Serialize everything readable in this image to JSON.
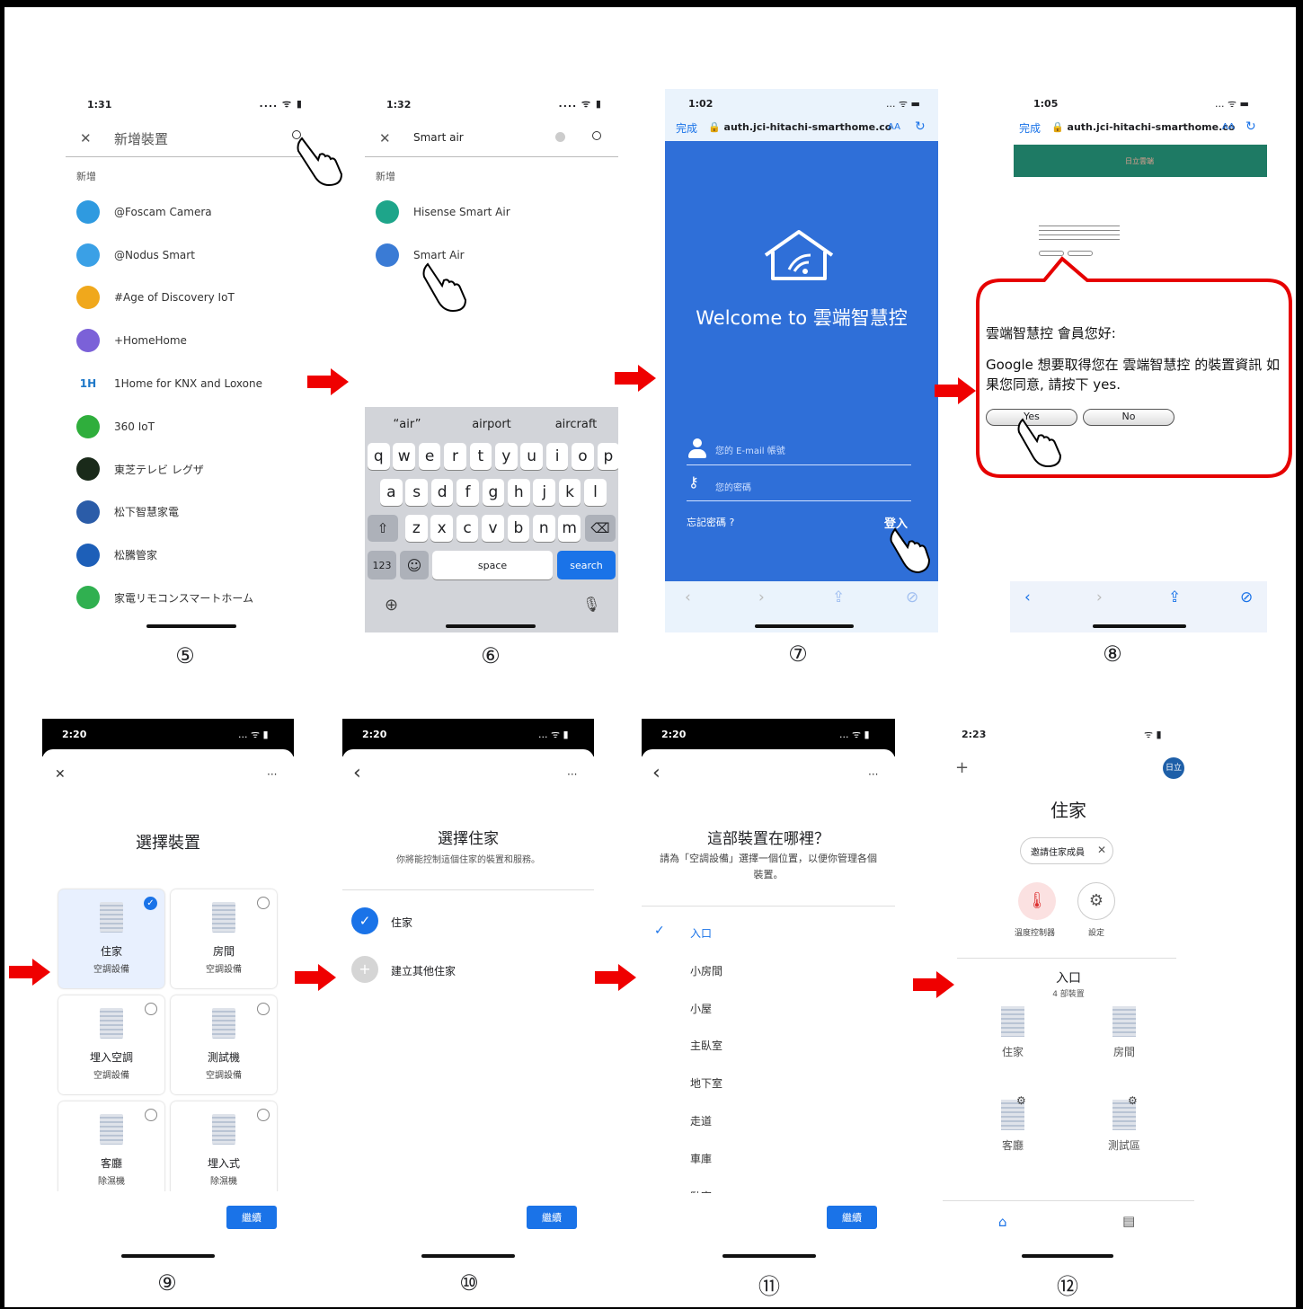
{
  "step_numbers": [
    "⑤",
    "⑥",
    "⑦",
    "⑧",
    "⑨",
    "⑩",
    "⑪",
    "⑫"
  ],
  "colors": {
    "arrow": "#ef0000",
    "google_blue": "#1a73e8",
    "hitachi_blue": "#2f6fd8",
    "hitachi_green": "#1e7a64"
  },
  "s5": {
    "time": "1:31",
    "status_icons": ".... ᯤ ▮",
    "close_icon": "✕",
    "search_title": "新增裝置",
    "section": "新增",
    "items": [
      {
        "name": "@Foscam Camera",
        "icon": "cloud-icon",
        "color": "#2f9ae0"
      },
      {
        "name": "@Nodus Smart",
        "icon": "at-icon",
        "color": "#3aa0e6"
      },
      {
        "name": "#Age of Discovery IoT",
        "icon": "globe-icon",
        "color": "#f0a81c"
      },
      {
        "name": "+HomeHome",
        "icon": "building-icon",
        "color": "#7b61d8"
      },
      {
        "name": "1Home for KNX and Loxone",
        "icon": "1h-icon",
        "color": "#ffffff"
      },
      {
        "name": "360 IoT",
        "icon": "plus-icon",
        "color": "#2fae3c"
      },
      {
        "name": "東芝テレビ レグザ",
        "icon": "regza-icon",
        "color": "#1a2a1a"
      },
      {
        "name": "松下智慧家電",
        "icon": "panasonic-icon",
        "color": "#2b5ca8"
      },
      {
        "name": "松騰管家",
        "icon": "m-icon",
        "color": "#1d5fb8"
      },
      {
        "name": "家電リモコンスマートホーム",
        "icon": "house-icon",
        "color": "#30b050"
      }
    ],
    "onehour_label": "1H"
  },
  "s6": {
    "time": "1:32",
    "status_icons": ".... ᯤ ▮",
    "close_icon": "✕",
    "search_value": "Smart air",
    "section": "新增",
    "items": [
      {
        "name": "Hisense Smart Air",
        "icon": "hisense-icon",
        "color": "#1ea58a"
      },
      {
        "name": "Smart Air",
        "icon": "smart-air-icon",
        "color": "#3a7bd5"
      }
    ],
    "suggestions": [
      "“air”",
      "airport",
      "aircraft"
    ],
    "row1": [
      "q",
      "w",
      "e",
      "r",
      "t",
      "y",
      "u",
      "i",
      "o",
      "p"
    ],
    "row2": [
      "a",
      "s",
      "d",
      "f",
      "g",
      "h",
      "j",
      "k",
      "l"
    ],
    "row3": [
      "z",
      "x",
      "c",
      "v",
      "b",
      "n",
      "m"
    ],
    "shift": "⇧",
    "backspace": "⌫",
    "num_key": "123",
    "emoji_key": "☺",
    "space": "space",
    "search": "search",
    "globe": "⊕",
    "mic": "🎙"
  },
  "s7": {
    "time": "1:02",
    "status_icons": "... ᯤ ▬",
    "done": "完成",
    "url": "🔒 auth.jci-hitachi-smarthome.co",
    "aa": "AA",
    "reload": "↻",
    "welcome": "Welcome to 雲端智慧控",
    "email_placeholder": "您的 E-mail 帳號",
    "password_placeholder": "您的密碼",
    "forgot": "忘記密碼 ?",
    "login": "登入",
    "nav": [
      "‹",
      "›",
      "⇪",
      "⊘"
    ]
  },
  "s8": {
    "time": "1:05",
    "status_icons": "... ᯤ ▬",
    "done": "完成",
    "url": "🔒 auth.jci-hitachi-smarthome.co",
    "aa": "AA",
    "reload": "↻",
    "header_text": "日立雲端",
    "greeting": "雲端智慧控 會員您好:",
    "message": "Google 想要取得您在 雲端智慧控 的裝置資訊 如果您同意, 請按下 yes.",
    "yes": "Yes",
    "no": "No",
    "nav": [
      "‹",
      "›",
      "⇪",
      "⊘"
    ]
  },
  "s9": {
    "time": "2:20",
    "status_icons": "... ᯤ ▮",
    "close_icon": "✕",
    "more_icon": "···",
    "title": "選擇裝置",
    "devices": [
      {
        "name": "住家",
        "type": "空調設備",
        "selected": true
      },
      {
        "name": "房間",
        "type": "空調設備",
        "selected": false
      },
      {
        "name": "埋入空調",
        "type": "空調設備",
        "selected": false
      },
      {
        "name": "測試機",
        "type": "空調設備",
        "selected": false
      },
      {
        "name": "客廳",
        "type": "除濕機",
        "selected": false
      },
      {
        "name": "埋入式",
        "type": "除濕機",
        "selected": false
      }
    ],
    "continue": "繼續"
  },
  "s10": {
    "time": "2:20",
    "status_icons": "... ᯤ ▮",
    "back_icon": "‹",
    "more_icon": "···",
    "title": "選擇住家",
    "subtitle": "你將能控制這個住家的裝置和服務。",
    "home": "住家",
    "create": "建立其他住家",
    "continue": "繼續"
  },
  "s11": {
    "time": "2:20",
    "status_icons": "... ᯤ ▮",
    "back_icon": "‹",
    "more_icon": "···",
    "title": "這部裝置在哪裡？",
    "subtitle": "請為「空調設備」選擇一個位置，以便你管理各個裝置。",
    "locations": [
      "入口",
      "小房間",
      "小屋",
      "主臥室",
      "地下室",
      "走道",
      "車庫",
      "臥室"
    ],
    "continue": "繼續"
  },
  "s12": {
    "time": "2:23",
    "status_icons": "ᯤ ▮",
    "add_icon": "+",
    "avatar": "日立",
    "title": "住家",
    "invite": "邀請住家成員",
    "invite_close": "✕",
    "thermostat": "溫度控制器",
    "settings": "設定",
    "room": "入口",
    "room_count": "4 部裝置",
    "devices": [
      "住家",
      "房間",
      "客廳",
      "測試區"
    ]
  }
}
